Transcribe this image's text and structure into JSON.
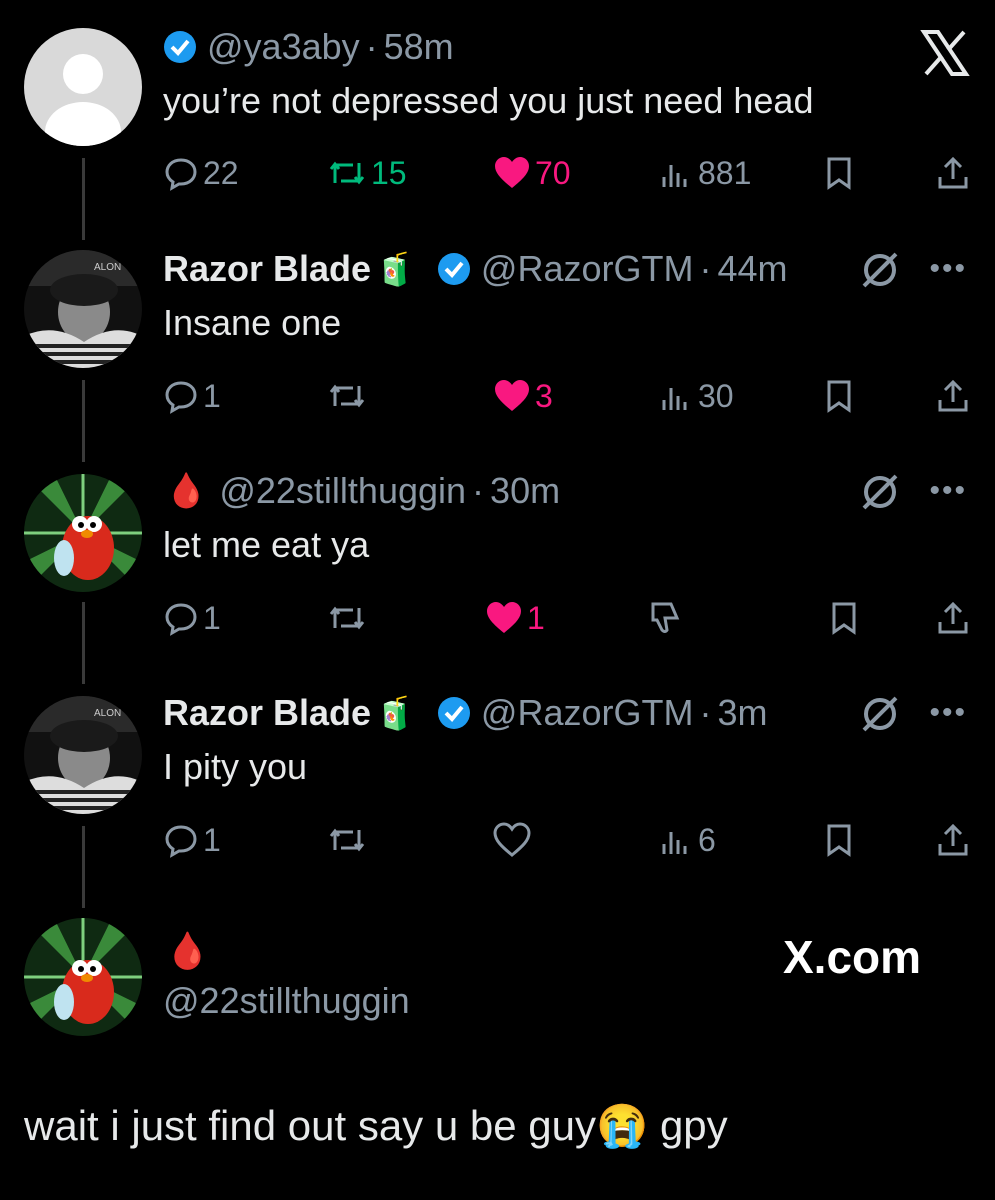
{
  "brand": {
    "x_logo": "X",
    "watermark": "X.com"
  },
  "posts": [
    {
      "handle": "@ya3aby",
      "time": "58m",
      "text": "you’re not depressed you just need head",
      "replies": "22",
      "reposts": "15",
      "likes": "70",
      "views": "881",
      "liked": true,
      "reposted": true,
      "verified": true
    },
    {
      "name": "Razor Blade",
      "name_emoji": "🧃",
      "handle": "@RazorGTM",
      "time": "44m",
      "text": "Insane one",
      "replies": "1",
      "reposts": "",
      "likes": "3",
      "views": "30",
      "liked": true,
      "verified": true
    },
    {
      "name_emoji": "🩸",
      "handle": "@22stillthuggin",
      "time": "30m",
      "text": "let me eat ya",
      "replies": "1",
      "reposts": "",
      "likes": "1",
      "liked": true,
      "verified": false
    },
    {
      "name": "Razor Blade",
      "name_emoji": "🧃",
      "handle": "@RazorGTM",
      "time": "3m",
      "text": "I pity you",
      "replies": "1",
      "reposts": "",
      "likes": "",
      "views": "6",
      "liked": false,
      "verified": true
    },
    {
      "name_emoji": "🩸",
      "handle": "@22stillthuggin"
    }
  ],
  "caption": "wait i just find out say u be guy😭 gpy",
  "colors": {
    "bg": "#000000",
    "text": "#e7e9ea",
    "muted": "#8b98a5",
    "like": "#f91880",
    "repost": "#00ba7c",
    "verified": "#1d9bf0"
  }
}
